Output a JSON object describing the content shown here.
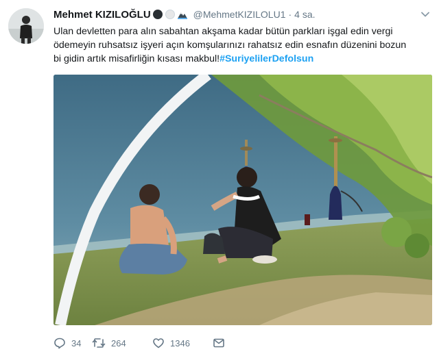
{
  "tweet": {
    "display_name": "Mehmet KIZILOĞLU",
    "handle": "@MehmetKIZILOLU1",
    "separator": "·",
    "time": "4 sa.",
    "text_lines": [
      "Ulan devletten para alın sabahtan akşama kadar bütün parkları işgal edin vergi",
      "ödemeyin ruhsatsız işyeri açın komşularınızı rahatsız edin esnafın düzenini bozun",
      "bi gidin artık misafirliğin kısası makbul!"
    ],
    "hashtag": "#SuriyelilerDefolsun",
    "media_description": "photo",
    "actions": {
      "reply_count": "34",
      "retweet_count": "264",
      "like_count": "1346"
    },
    "icons": {
      "reply": "reply-icon",
      "retweet": "retweet-icon",
      "like": "heart-icon",
      "message": "envelope-icon",
      "caret": "chevron-down-icon"
    },
    "colors": {
      "text": "#14171a",
      "secondary": "#657786",
      "link": "#1da1f2"
    }
  }
}
